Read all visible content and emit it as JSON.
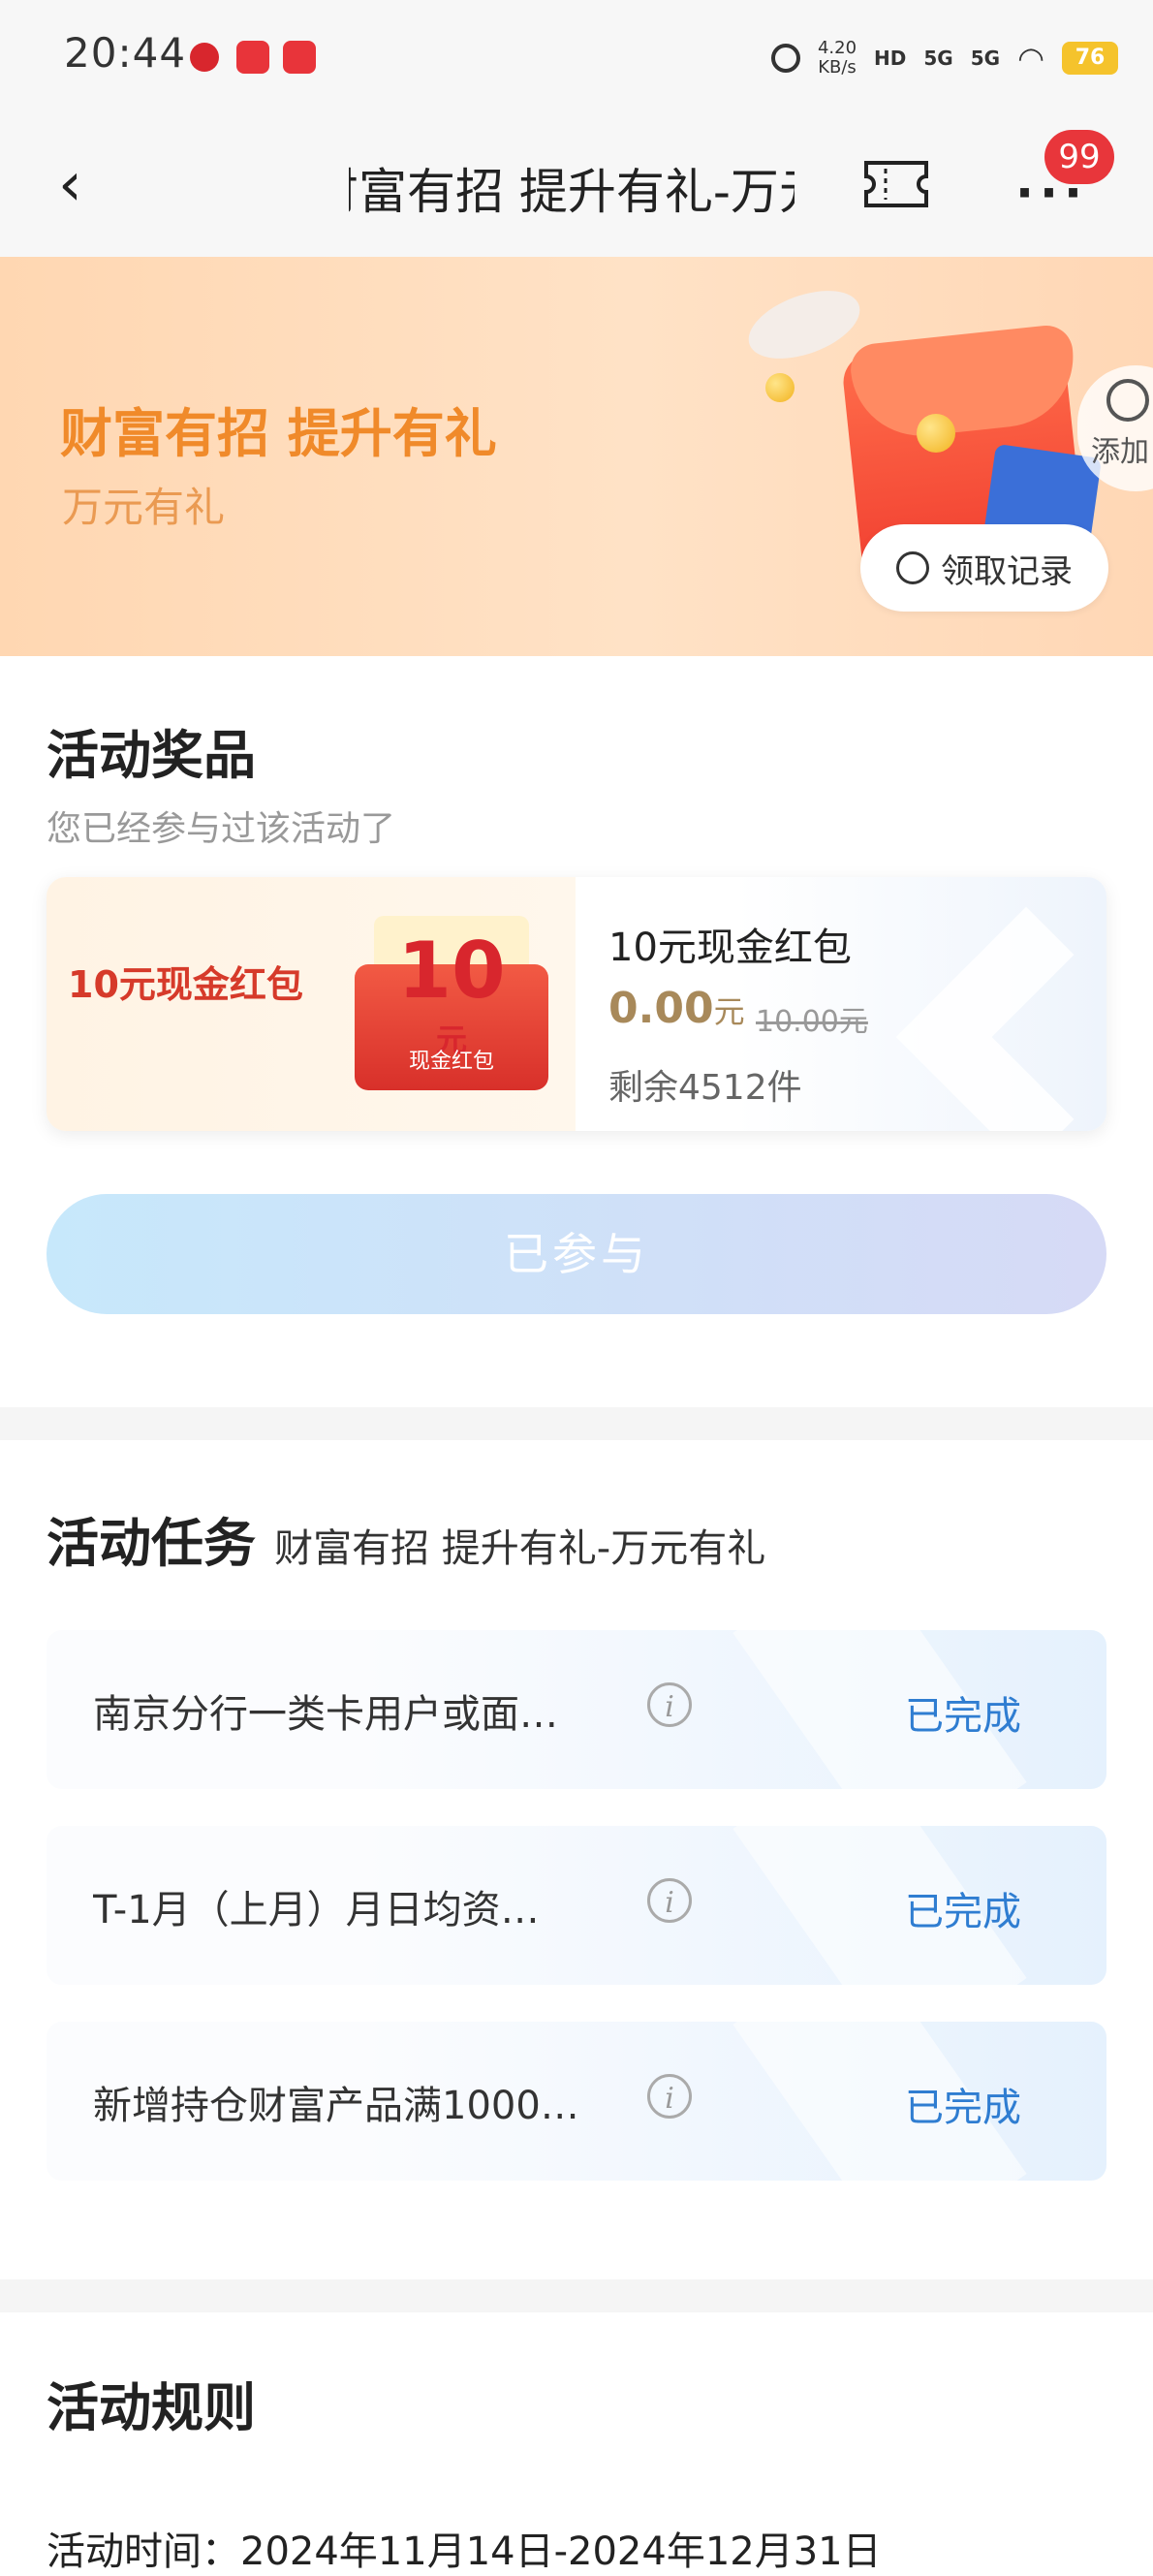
{
  "status_bar": {
    "time": "20:44",
    "network_speed_value": "4.20",
    "network_speed_unit": "KB/s",
    "hd_label": "HD",
    "signal1": "5G",
    "signal2": "5G",
    "battery": "76",
    "icons": [
      "unicom-icon",
      "app-notification-icon",
      "app-notification-icon",
      "alarm-icon",
      "wifi-icon"
    ]
  },
  "nav": {
    "title": "财富有招 提升有礼-万元有礼",
    "badge_count": "99",
    "more_label": "···"
  },
  "banner": {
    "title": "财富有招 提升有礼",
    "subtitle": "万元有礼",
    "add_label": "添加",
    "record_button": "领取记录"
  },
  "prizes": {
    "title": "活动奖品",
    "subtitle": "您已经参与过该活动了",
    "card": {
      "left_label": "10元现金红包",
      "image_amount": "10",
      "image_unit": "元",
      "image_caption": "现金红包",
      "name": "10元现金红包",
      "price": "0.00",
      "price_unit": "元",
      "original_price": "10.00元",
      "remaining": "剩余4512件"
    },
    "joined_button": "已参与"
  },
  "tasks": {
    "title": "活动任务",
    "subtitle": "财富有招 提升有礼-万元有礼",
    "items": [
      {
        "label": "南京分行一类卡用户或面…",
        "status": "已完成"
      },
      {
        "label": "T-1月（上月）月日均资…",
        "status": "已完成"
      },
      {
        "label": "新增持仓财富产品满1000…",
        "status": "已完成"
      }
    ]
  },
  "rules": {
    "title": "活动规则",
    "time_text": "活动时间：2024年11月14日-2024年12月31日"
  },
  "colors": {
    "accent_orange": "#f08a2a",
    "status_blue": "#2f7dd1",
    "badge_red": "#e8363b",
    "price_gold": "#a8895a"
  }
}
